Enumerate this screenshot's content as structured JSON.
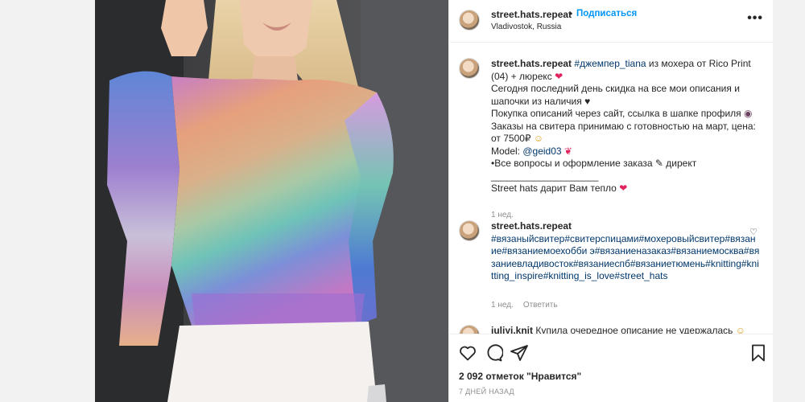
{
  "header": {
    "username": "street.hats.repeat",
    "dot": "•",
    "follow": "Подписаться",
    "location": "Vladivostok, Russia",
    "more": "•••"
  },
  "caption": {
    "username": "street.hats.repeat",
    "tag": "#джемпер_tiana",
    "line1_rest": " из мохера от Rico Print (04) + люрекс ",
    "line2": "Сегодня последний день скидка на все мои описания и шапочки из наличия ",
    "line3": "Покупка описаний через сайт, ссылка в шапке профиля ",
    "line4": "Заказы на свитера принимаю с готовностью на март, цена: от 7500₽ ",
    "model_prefix": "Model: ",
    "model_handle": "@geid03",
    "line6": "•Все вопросы и оформление заказа ",
    "line6_end": " директ",
    "separator": "____________________",
    "line7": "Street hats дарит Вам тепло ",
    "time": "1 нед."
  },
  "comment": {
    "username": "street.hats.repeat",
    "hashtags": "#вязаныйсвитер#свитерспицами#мохеровыйсвитер#вязание#вязаниемоехобби э#вязаниеназаказ#вязаниемосква#вязаниевладивосток#вязаниеспб#вязаниетюмень#knitting#knitting_inspire#knitting_is_love#street_hats",
    "time": "1 нед.",
    "reply": "Ответить"
  },
  "partial_comment": {
    "username": "iuliyi.knit",
    "text": "Купила очередное описание не удержалась "
  },
  "likes": "2 092 отметок \"Нравится\"",
  "timestamp": "7 ДНЕЙ НАЗАД"
}
